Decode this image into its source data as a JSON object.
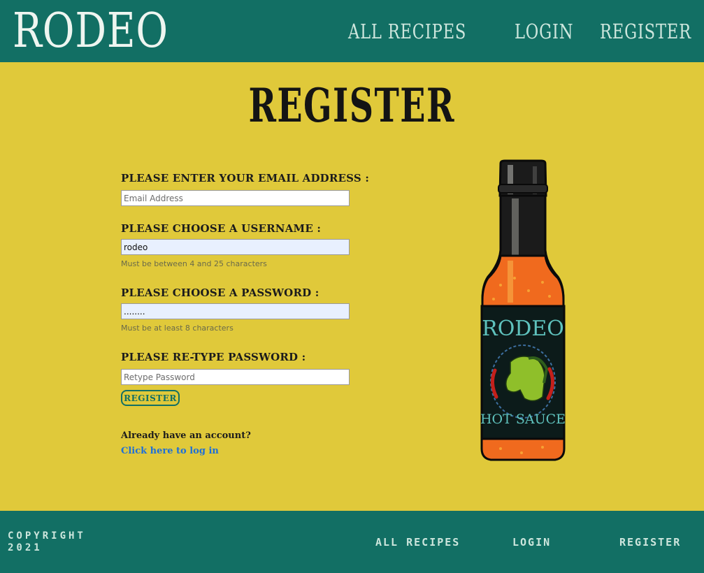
{
  "header": {
    "logo": "RODEO",
    "nav": {
      "all_recipes": "ALL RECIPES",
      "login": "LOGIN",
      "register": "REGISTER"
    }
  },
  "main": {
    "title": "REGISTER",
    "form": {
      "email": {
        "label": "PLEASE ENTER YOUR EMAIL ADDRESS :",
        "placeholder": "Email Address",
        "value": ""
      },
      "username": {
        "label": "PLEASE CHOOSE A USERNAME :",
        "value": "rodeo",
        "hint": "Must be between 4 and 25 characters"
      },
      "password": {
        "label": "PLEASE CHOOSE A PASSWORD :",
        "value": "........",
        "hint": "Must be at least 8 characters"
      },
      "retype": {
        "label": "PLEASE RE-TYPE PASSWORD :",
        "placeholder": "Retype Password",
        "value": ""
      },
      "submit": "REGISTER"
    },
    "account_prompt": "Already have an account?",
    "login_link": "Click here to log in",
    "bottle": {
      "brand": "RODEO",
      "product": "HOT SAUCE"
    }
  },
  "footer": {
    "copyright_line1": "COPYRIGHT",
    "copyright_line2": "2021",
    "nav": {
      "all_recipes": "ALL RECIPES",
      "login": "LOGIN",
      "register": "REGISTER"
    }
  },
  "colors": {
    "header_bg": "#126f64",
    "page_bg": "#e0c93a",
    "link": "#1e6fd8"
  }
}
